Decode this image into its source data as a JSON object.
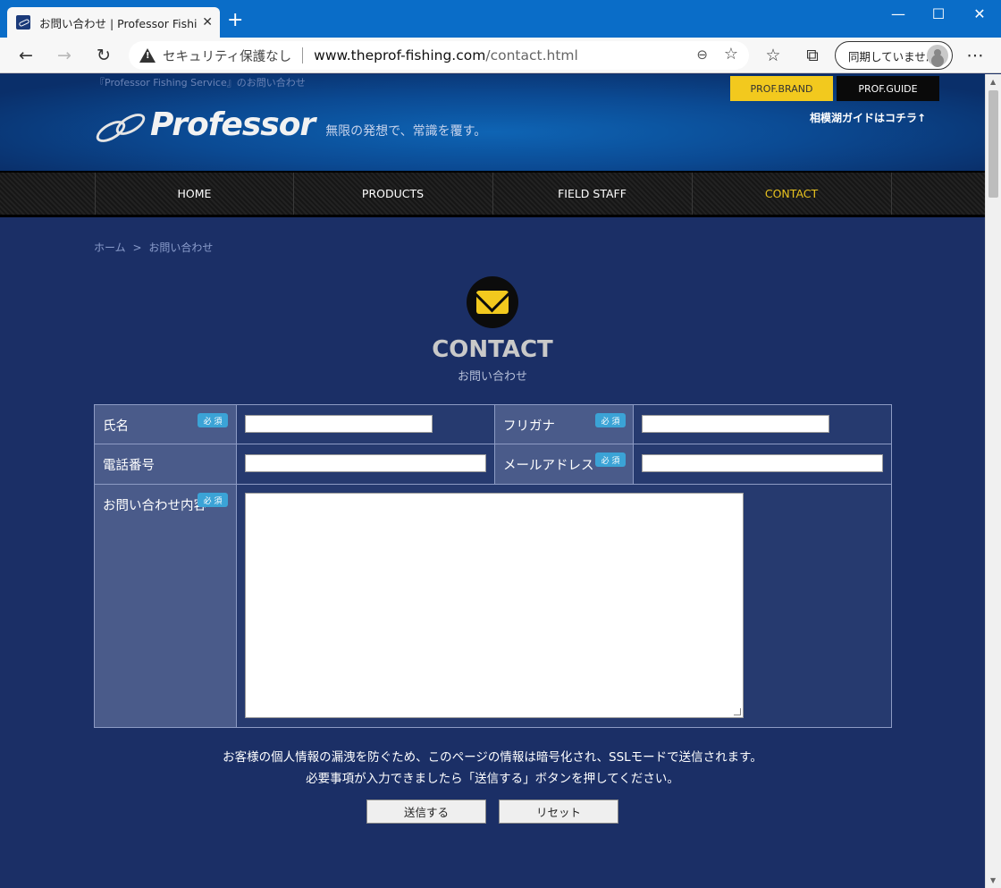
{
  "browser": {
    "tab_title": "お問い合わせ | Professor Fishing S",
    "tab_close": "✕",
    "new_tab": "+",
    "security_label": "セキュリティ保護なし",
    "url_host": "www.theprof-fishing.com",
    "url_path": "/contact.html",
    "sync_label": "同期していません",
    "controls": {
      "minimize": "—",
      "maximize": "☐",
      "close": "✕"
    },
    "icons": [
      "back-arrow-icon",
      "forward-arrow-icon",
      "refresh-icon",
      "warning-icon",
      "zoom-out-icon",
      "favorite-add-icon",
      "favorites-icon",
      "collections-icon",
      "avatar",
      "more-icon"
    ]
  },
  "header": {
    "tagline": "『Professor Fishing Service』のお問い合わせ",
    "logo_name": "Professor",
    "slogan": "無限の発想で、常識を覆す。",
    "brand_button": "PROF.BRAND",
    "guide_button": "PROF.GUIDE",
    "guide_link": "相模湖ガイドはコチラ↑"
  },
  "nav": {
    "items": [
      {
        "label": "HOME"
      },
      {
        "label": "PRODUCTS"
      },
      {
        "label": "FIELD STAFF"
      },
      {
        "label": "CONTACT"
      }
    ],
    "active_color": "#e8c21f"
  },
  "breadcrumb": {
    "home": "ホーム",
    "separator": ">",
    "current": "お問い合わせ"
  },
  "contact": {
    "title": "CONTACT",
    "subtitle": "お問い合わせ"
  },
  "form": {
    "required_badge": "必 須",
    "fields": {
      "name": {
        "label": "氏名",
        "value": ""
      },
      "furigana": {
        "label": "フリガナ",
        "value": ""
      },
      "phone": {
        "label": "電話番号",
        "value": ""
      },
      "email": {
        "label": "メールアドレス",
        "value": ""
      },
      "message": {
        "label": "お問い合わせ内容",
        "value": ""
      }
    }
  },
  "notice": {
    "line1": "お客様の個人情報の漏洩を防ぐため、このページの情報は暗号化され、SSLモードで送信されます。",
    "line2": "必要事項が入力できましたら「送信する」ボタンを押してください。"
  },
  "buttons": {
    "submit": "送信する",
    "reset": "リセット"
  },
  "colors": {
    "page_bg": "#1b2f66",
    "accent_yellow": "#f2c91e",
    "required_badge": "#3ba3d6",
    "label_bg": "#4a5b8a"
  }
}
